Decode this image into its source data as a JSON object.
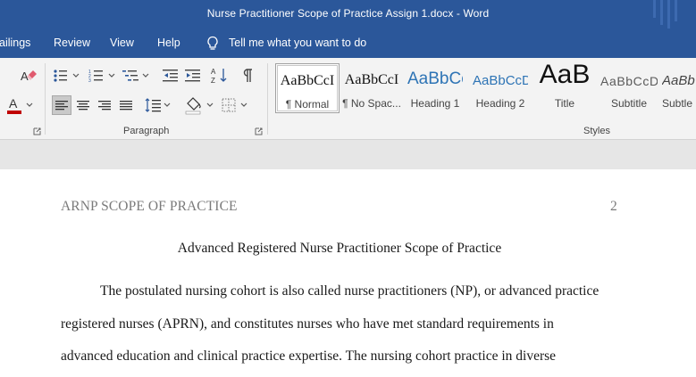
{
  "window": {
    "title": "Nurse Practitioner Scope of Practice Assign 1.docx  -  Word"
  },
  "menu": {
    "tabs": [
      "ailings",
      "Review",
      "View",
      "Help"
    ],
    "tell_me": "Tell me what you want to do"
  },
  "ribbon": {
    "paragraph_label": "Paragraph",
    "styles_label": "Styles",
    "styles": [
      {
        "sample": "AaBbCcI",
        "name": "¶ Normal",
        "selected": true
      },
      {
        "sample": "AaBbCcI",
        "name": "¶ No Spac..."
      },
      {
        "sample": "AaBbCc",
        "name": "Heading 1"
      },
      {
        "sample": "AaBbCcD",
        "name": "Heading 2"
      },
      {
        "sample": "AaB",
        "name": "Title"
      },
      {
        "sample": "AaBbCcD",
        "name": "Subtitle"
      },
      {
        "sample": "AaBb",
        "name": "Subtle"
      }
    ],
    "colors": {
      "accent": "#2b579a",
      "font_color_bar": "#c00000",
      "heading_blue": "#2e74b5"
    }
  },
  "document": {
    "running_head": "ARNP SCOPE OF PRACTICE",
    "page_number": "2",
    "title": "Advanced Registered Nurse Practitioner Scope of Practice",
    "lines": [
      "The postulated nursing cohort is also called nurse practitioners (NP), or advanced practice",
      "registered nurses (APRN), and constitutes nurses who have met standard requirements in",
      "advanced education and clinical practice expertise. The nursing cohort practice in diverse"
    ]
  }
}
